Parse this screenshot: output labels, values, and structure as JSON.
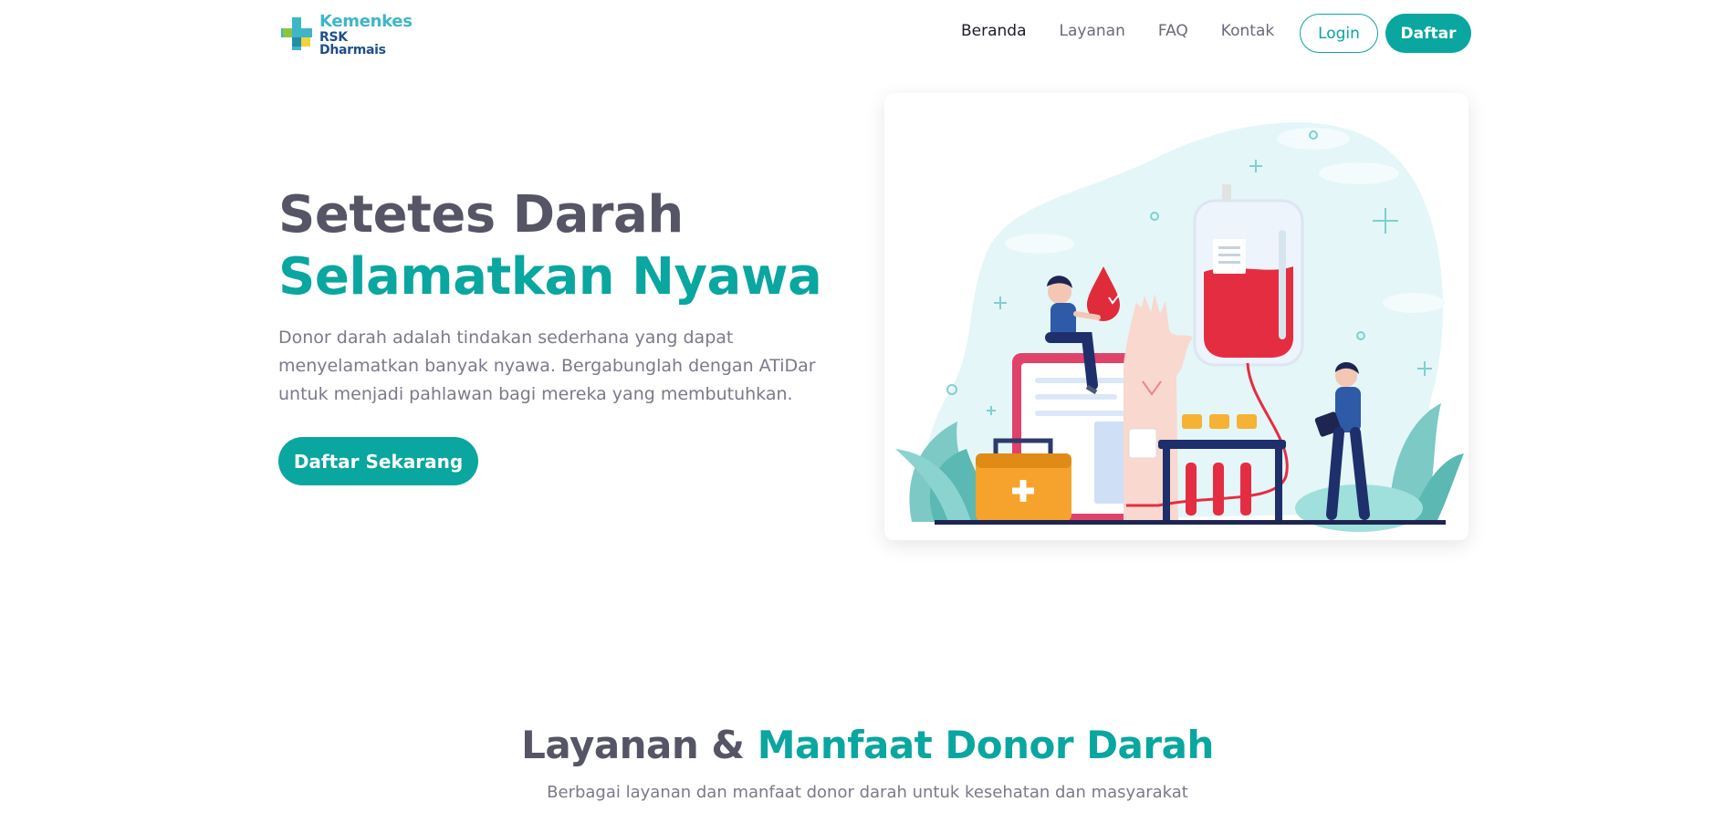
{
  "brand": {
    "line1": "Kemenkes",
    "line2": "RSK Dharmais",
    "colors": {
      "primary": "#0aa6a0",
      "logo_teal": "#3fb6c8",
      "logo_navy": "#1f4f8a",
      "logo_green": "#8cc63f",
      "logo_yellow": "#f3d23b"
    }
  },
  "nav": {
    "items": [
      {
        "label": "Beranda",
        "active": true
      },
      {
        "label": "Layanan",
        "active": false
      },
      {
        "label": "FAQ",
        "active": false
      },
      {
        "label": "Kontak",
        "active": false
      }
    ],
    "login_label": "Login",
    "register_label": "Daftar"
  },
  "hero": {
    "title_line1": "Setetes Darah",
    "title_line2": "Selamatkan Nyawa",
    "description": "Donor darah adalah tindakan sederhana yang dapat menyelamatkan banyak nyawa. Bergabunglah dengan ATiDar untuk menjadi pahlawan bagi mereka yang membutuhkan.",
    "cta_label": "Daftar Sekarang",
    "illustration": "blood-donation-illustration"
  },
  "services": {
    "title_part1": "Layanan &",
    "title_part2": "Manfaat Donor Darah",
    "subtitle": "Berbagai layanan dan manfaat donor darah untuk kesehatan dan masyarakat"
  }
}
